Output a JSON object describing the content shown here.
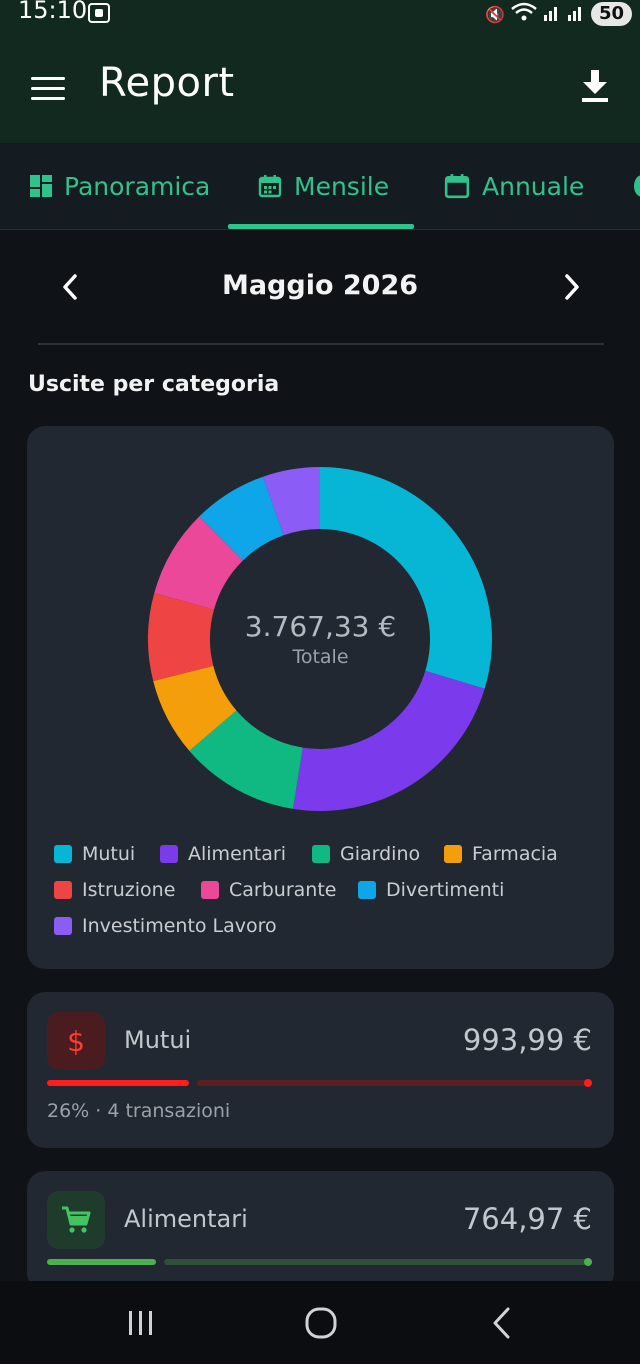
{
  "status": {
    "time": "15:10",
    "battery": "50"
  },
  "app": {
    "title": "Report"
  },
  "tabs": [
    {
      "label": "Panoramica",
      "icon": "dashboard-icon"
    },
    {
      "label": "Mensile",
      "icon": "calendar-icon"
    },
    {
      "label": "Annuale",
      "icon": "calendar-icon"
    }
  ],
  "month": {
    "label": "Maggio 2026"
  },
  "section": {
    "title": "Uscite per categoria"
  },
  "chart_data": {
    "type": "pie",
    "title": "",
    "center_value": "3.767,33 €",
    "center_label": "Totale",
    "categories": [
      "Mutui",
      "Alimentari",
      "Giardino",
      "Farmacia",
      "Istruzione",
      "Carburante",
      "Divertimenti",
      "Investimento Lavoro"
    ],
    "values": [
      993.99,
      764.97,
      376,
      246,
      276,
      278,
      235,
      180
    ],
    "colors": [
      "#06b6d4",
      "#7c3aed",
      "#10b981",
      "#f59e0b",
      "#ef4444",
      "#ec4899",
      "#0ea5e9",
      "#8b5cf6"
    ]
  },
  "categories": [
    {
      "name": "Mutui",
      "amount": "993,99 €",
      "meta": "26% · 4 transazioni",
      "percent": 26,
      "icon": "$",
      "icon_name": "dollar-icon",
      "icon_bg": "#4a1c1f",
      "icon_color": "#ff3b30",
      "bar_color": "#ff1d1d",
      "rest_color": "#5c1f22"
    },
    {
      "name": "Alimentari",
      "amount": "764,97 €",
      "meta": "",
      "percent": 20,
      "icon": "",
      "icon_name": "cart-icon",
      "icon_bg": "#1f3b2b",
      "icon_color": "#43c463",
      "bar_color": "#4caf50",
      "rest_color": "#2e4f39"
    }
  ]
}
